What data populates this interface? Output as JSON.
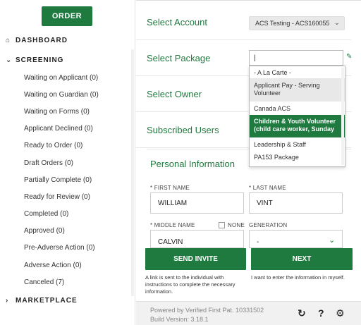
{
  "sidebar": {
    "order_button": "ORDER",
    "dashboard_label": "DASHBOARD",
    "screening_label": "SCREENING",
    "marketplace_label": "MARKETPLACE",
    "screening_items": [
      {
        "label": "Waiting on Applicant (0)"
      },
      {
        "label": "Waiting on Guardian (0)"
      },
      {
        "label": "Waiting on Forms (0)"
      },
      {
        "label": "Applicant Declined (0)"
      },
      {
        "label": "Ready to Order (0)"
      },
      {
        "label": "Draft Orders (0)"
      },
      {
        "label": "Partially Complete (0)"
      },
      {
        "label": "Ready for Review (0)"
      },
      {
        "label": "Completed (0)"
      },
      {
        "label": "Approved (0)"
      },
      {
        "label": "Pre-Adverse Action (0)"
      },
      {
        "label": "Adverse Action (0)"
      },
      {
        "label": "Canceled (7)"
      }
    ]
  },
  "form": {
    "select_account_label": "Select Account",
    "account_value": "ACS Testing - ACS160055",
    "select_package_label": "Select Package",
    "package_input_value": "|",
    "select_owner_label": "Select Owner",
    "subscribed_users_label": "Subscribed Users",
    "package_options": [
      {
        "label": "- A La Carte -"
      },
      {
        "label": "Applicant Pay - Serving Volunteer"
      },
      {
        "label": "Canada ACS"
      },
      {
        "label": "Children & Youth Volunteer (child care worker, Sunday"
      },
      {
        "label": "Leadership & Staff"
      },
      {
        "label": "PA153 Package"
      }
    ]
  },
  "personal": {
    "title": "Personal Information",
    "first_name_label": "* FIRST NAME",
    "first_name_value": "WILLIAM",
    "last_name_label": "* LAST NAME",
    "last_name_value": "VINT",
    "middle_name_label": "* MIDDLE NAME",
    "middle_name_value": "CALVIN",
    "none_label": "NONE",
    "generation_label": "GENERATION",
    "generation_value": "-"
  },
  "actions": {
    "send_invite": "SEND INVITE",
    "send_invite_hint": "A link is sent to the individual with instructions to complete the necessary information.",
    "next": "NEXT",
    "next_hint": "I want to enter the information in myself."
  },
  "footer": {
    "powered_by": "Powered by Verified First   Pat. 10331502",
    "build_version": "Build Version: 3.18.1"
  },
  "colors": {
    "brand_green": "#1e7a3e"
  }
}
